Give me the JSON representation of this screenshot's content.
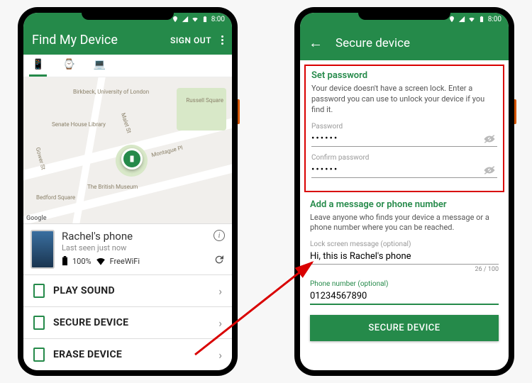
{
  "statusbar": {
    "time": "8:00"
  },
  "screen1": {
    "title": "Find My Device",
    "signout": "SIGN OUT",
    "tabs": {
      "phone": "📱",
      "watch": "⌚",
      "laptop": "💻"
    },
    "map": {
      "label_birkbeck": "Birkbeck, University of London",
      "label_russell": "Russell Square",
      "label_senate": "Senate House Library",
      "label_museum": "The British Museum",
      "label_gower": "Gower St",
      "label_bedford": "Bedford Square",
      "label_montague": "Montague Pl",
      "label_malet": "Malet St",
      "google": "Google"
    },
    "device": {
      "name": "Rachel's phone",
      "last_seen": "Last seen just now",
      "battery": "100%",
      "wifi": "FreeWiFi"
    },
    "actions": {
      "play_sound": "PLAY SOUND",
      "secure": "SECURE DEVICE",
      "erase": "ERASE DEVICE"
    }
  },
  "screen2": {
    "title": "Secure device",
    "set_password": {
      "heading": "Set password",
      "desc": "Your device doesn't have a screen lock. Enter a password you can use to unlock your device if you find it.",
      "password_label": "Password",
      "password_value": "••••••",
      "confirm_label": "Confirm password",
      "confirm_value": "••••••"
    },
    "message": {
      "heading": "Add a message or phone number",
      "desc": "Leave anyone who finds your device a message or a phone number where you can be reached.",
      "msg_label": "Lock screen message (optional)",
      "msg_value": "Hi, this is Rachel's phone",
      "msg_counter": "26 / 100",
      "phone_label": "Phone number (optional)",
      "phone_value": "01234567890"
    },
    "button": "SECURE DEVICE"
  }
}
